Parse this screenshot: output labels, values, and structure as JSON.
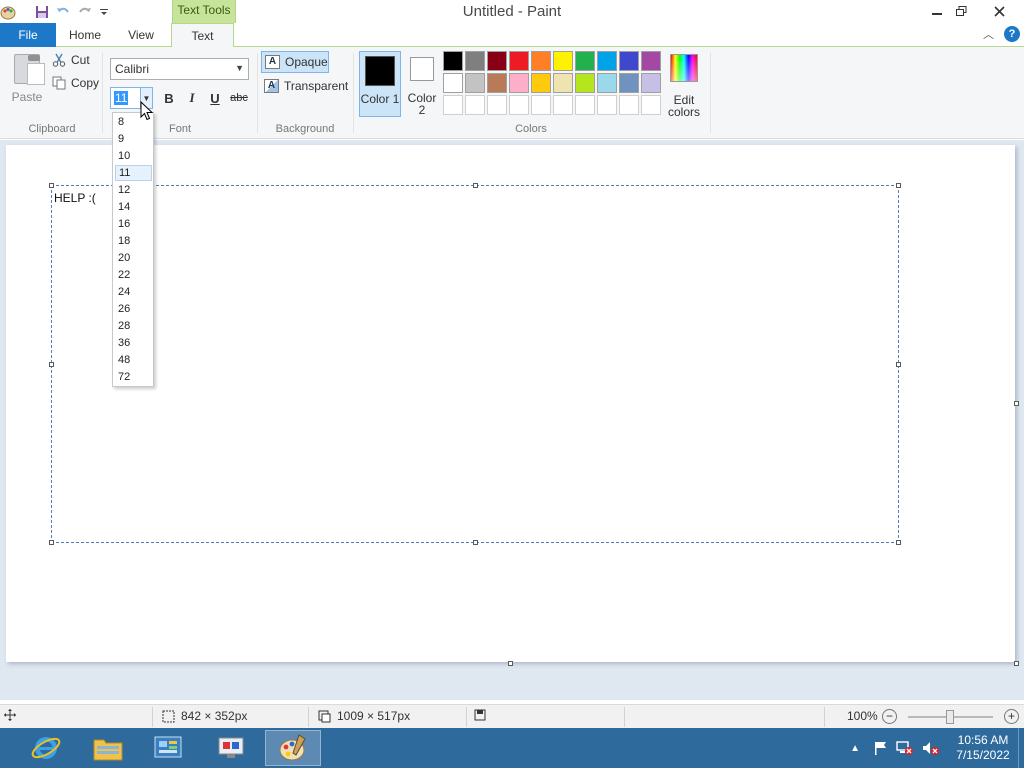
{
  "window": {
    "title": "Untitled - Paint",
    "context_tab": "Text Tools"
  },
  "tabs": [
    {
      "label": "File"
    },
    {
      "label": "Home"
    },
    {
      "label": "View"
    },
    {
      "label": "Text"
    }
  ],
  "clipboard": {
    "paste_label": "Paste",
    "cut_label": "Cut",
    "copy_label": "Copy",
    "group_label": "Clipboard"
  },
  "font": {
    "family_value": "Calibri",
    "size_value": "11",
    "bold_label": "B",
    "italic_label": "I",
    "underline_label": "U",
    "strike_label": "abc",
    "group_label": "Font",
    "size_options": [
      "8",
      "9",
      "10",
      "11",
      "12",
      "14",
      "16",
      "18",
      "20",
      "22",
      "24",
      "26",
      "28",
      "36",
      "48",
      "72"
    ],
    "selected_option": "11"
  },
  "background": {
    "opaque_label": "Opaque",
    "transparent_label": "Transparent",
    "group_label": "Background"
  },
  "colors": {
    "color1_label": "Color 1",
    "color2_label": "Color 2",
    "edit_label": "Edit colors",
    "group_label": "Colors",
    "palette_row1": [
      "#000000",
      "#7f7f7f",
      "#880015",
      "#ed1c24",
      "#ff7f27",
      "#fff200",
      "#22b14c",
      "#00a2e8",
      "#3f48cc",
      "#a349a4"
    ],
    "palette_row2": [
      "#ffffff",
      "#c3c3c3",
      "#b97a57",
      "#ffaec9",
      "#ffc90e",
      "#efe4b0",
      "#b5e61d",
      "#99d9ea",
      "#7092be",
      "#c8bfe7"
    ],
    "palette_row3": [
      "#ffffff",
      "#ffffff",
      "#ffffff",
      "#ffffff",
      "#ffffff",
      "#ffffff",
      "#ffffff",
      "#ffffff",
      "#ffffff",
      "#ffffff"
    ]
  },
  "canvas": {
    "text": "HELP :("
  },
  "status": {
    "selection_size": "842 × 352px",
    "canvas_size": "1009 × 517px",
    "zoom": "100%"
  },
  "taskbar": {
    "time": "10:56 AM",
    "date": "7/15/2022"
  }
}
